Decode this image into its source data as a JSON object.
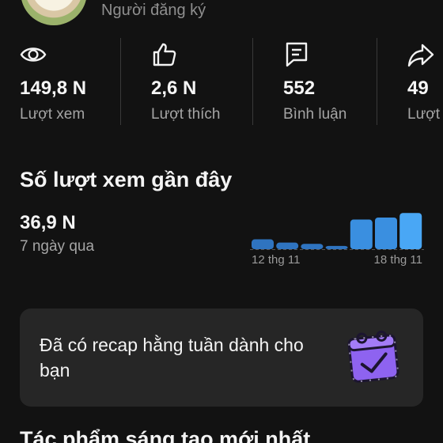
{
  "profile": {
    "subscriber_label": "Người đăng ký"
  },
  "stats": [
    {
      "icon": "eye-icon",
      "value": "149,8 N",
      "label": "Lượt xem"
    },
    {
      "icon": "thumbs-up-icon",
      "value": "2,6 N",
      "label": "Lượt thích"
    },
    {
      "icon": "comment-icon",
      "value": "552",
      "label": "Bình luận"
    },
    {
      "icon": "share-icon",
      "value": "49",
      "label": "Lượt"
    }
  ],
  "recent": {
    "title": "Số lượt xem gần đây",
    "value": "36,9 N",
    "caption": "7 ngày qua",
    "chart_data": {
      "type": "bar",
      "values": [
        0.24,
        0.16,
        0.13,
        0.08,
        0.72,
        0.77,
        0.88
      ],
      "start_label": "12 thg 11",
      "end_label": "18 thg 11",
      "colors": {
        "past": "#2f74c0",
        "recent": "#3a8fe0",
        "today": "#49a7f5"
      }
    }
  },
  "recap": {
    "text": "Đã có recap hằng tuần dành cho bạn",
    "icon": "calendar-check-icon",
    "icon_color": "#8e63f0"
  },
  "latest": {
    "title": "Tác phẩm sáng tạo mới nhất"
  }
}
